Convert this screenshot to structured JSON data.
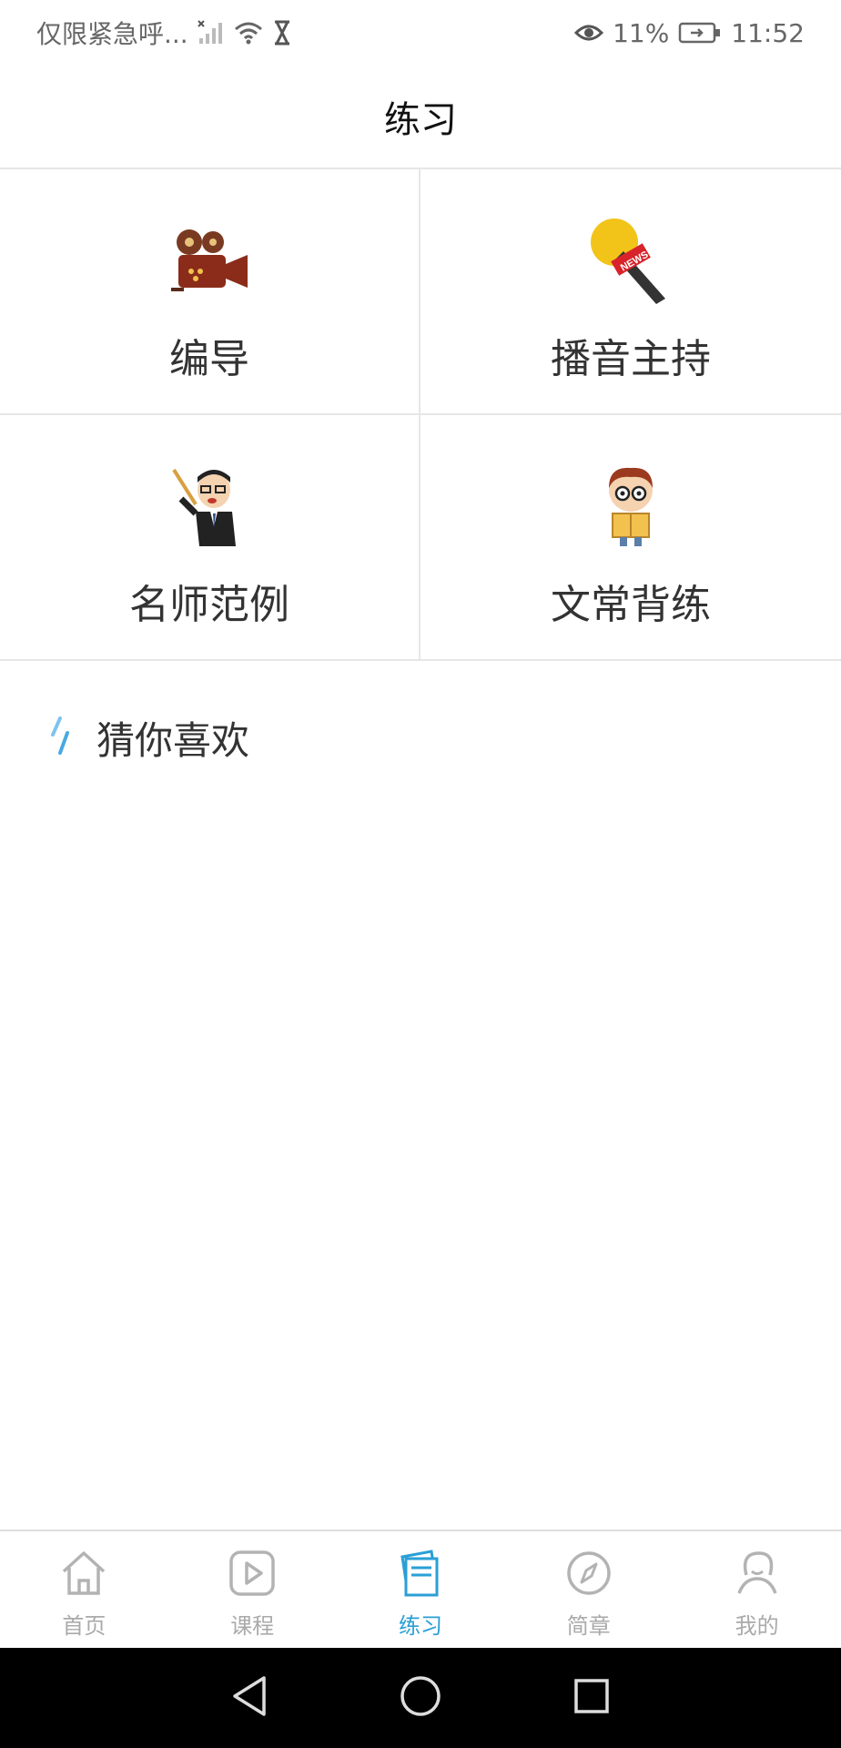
{
  "status_bar": {
    "carrier": "仅限紧急呼...",
    "battery": "11%",
    "time": "11:52"
  },
  "header": {
    "title": "练习"
  },
  "categories": [
    {
      "label": "编导",
      "icon": "film-projector-icon"
    },
    {
      "label": "播音主持",
      "icon": "news-microphone-icon"
    },
    {
      "label": "名师范例",
      "icon": "teacher-icon"
    },
    {
      "label": "文常背练",
      "icon": "reading-boy-icon"
    }
  ],
  "section": {
    "title": "猜你喜欢"
  },
  "tabs": [
    {
      "label": "首页",
      "icon": "home-icon",
      "active": false
    },
    {
      "label": "课程",
      "icon": "play-icon",
      "active": false
    },
    {
      "label": "练习",
      "icon": "practice-book-icon",
      "active": true
    },
    {
      "label": "简章",
      "icon": "compass-icon",
      "active": false
    },
    {
      "label": "我的",
      "icon": "profile-icon",
      "active": false
    }
  ],
  "colors": {
    "accent": "#2a9fd6",
    "inactive": "#aaaaaa"
  }
}
